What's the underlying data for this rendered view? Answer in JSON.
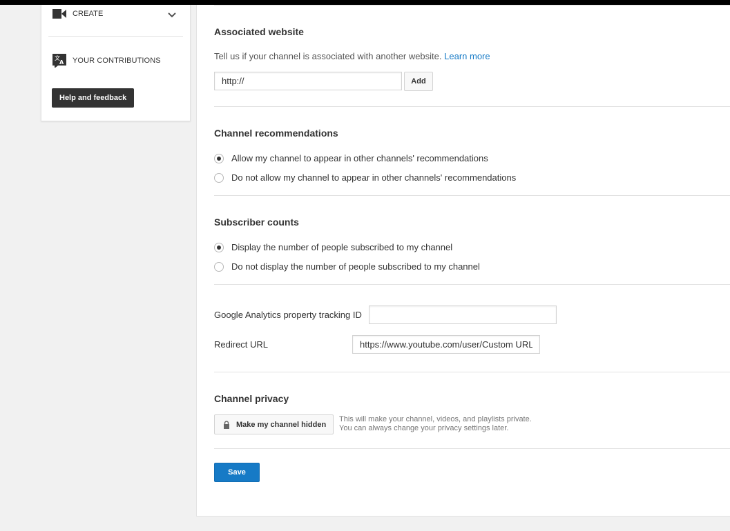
{
  "sidebar": {
    "create_label": "CREATE",
    "contributions_label": "YOUR CONTRIBUTIONS",
    "help_label": "Help and feedback"
  },
  "associated_website": {
    "title": "Associated website",
    "description": "Tell us if your channel is associated with another website.",
    "learn_more": "Learn more",
    "input_value": "http://",
    "add_label": "Add"
  },
  "recommendations": {
    "title": "Channel recommendations",
    "options": [
      {
        "label": "Allow my channel to appear in other channels' recommendations",
        "selected": true
      },
      {
        "label": "Do not allow my channel to appear in other channels' recommendations",
        "selected": false
      }
    ]
  },
  "subscriber_counts": {
    "title": "Subscriber counts",
    "options": [
      {
        "label": "Display the number of people subscribed to my channel",
        "selected": true
      },
      {
        "label": "Do not display the number of people subscribed to my channel",
        "selected": false
      }
    ]
  },
  "analytics": {
    "label": "Google Analytics property tracking ID",
    "value": ""
  },
  "redirect": {
    "label": "Redirect URL",
    "value": "https://www.youtube.com/user/Custom URL"
  },
  "privacy": {
    "title": "Channel privacy",
    "button_label": "Make my channel hidden",
    "note_line1": "This will make your channel, videos, and playlists private.",
    "note_line2": "You can always change your privacy settings later."
  },
  "save_label": "Save",
  "colors": {
    "accent": "#167ac6",
    "dark_button": "#333333"
  }
}
